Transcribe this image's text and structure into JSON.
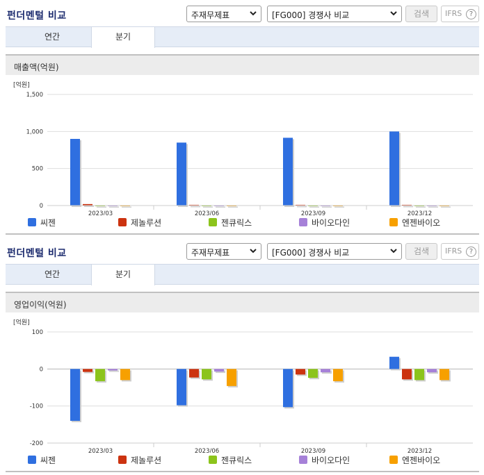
{
  "panels": [
    {
      "title": "펀더멘털 비교",
      "select1": "주재무제표",
      "select2": "[FG000] 경쟁사 비교",
      "search_label": "검색",
      "ifrs_label": "IFRS",
      "help_glyph": "?",
      "tabs": [
        "연간",
        "분기"
      ],
      "active_tab": "분기",
      "subtitle": "매출액(억원)",
      "unit_label": "[억원]"
    },
    {
      "title": "펀더멘털 비교",
      "select1": "주재무제표",
      "select2": "[FG000] 경쟁사 비교",
      "search_label": "검색",
      "ifrs_label": "IFRS",
      "help_glyph": "?",
      "tabs": [
        "연간",
        "분기"
      ],
      "active_tab": "분기",
      "subtitle": "영업이익(억원)",
      "unit_label": "[억원]"
    }
  ],
  "colors": {
    "씨젠": "#2f6fe0",
    "제놀루션": "#cc3310",
    "젠큐릭스": "#8cc41c",
    "바이오다인": "#a681d8",
    "엔젠바이오": "#f7a000"
  },
  "chart_data": [
    {
      "type": "bar",
      "title": "매출액(억원)",
      "ylabel": "[억원]",
      "categories": [
        "2023/03",
        "2023/06",
        "2023/09",
        "2023/12"
      ],
      "yticks": [
        "1,500",
        "1,000",
        "500",
        "0"
      ],
      "ylim": [
        0,
        1500
      ],
      "series": [
        {
          "name": "씨젠",
          "values": [
            900,
            850,
            915,
            1000
          ]
        },
        {
          "name": "제놀루션",
          "values": [
            20,
            10,
            10,
            10
          ]
        },
        {
          "name": "젠큐릭스",
          "values": [
            5,
            5,
            5,
            5
          ]
        },
        {
          "name": "바이오다인",
          "values": [
            5,
            5,
            5,
            5
          ]
        },
        {
          "name": "엔젠바이오",
          "values": [
            5,
            5,
            5,
            5
          ]
        }
      ]
    },
    {
      "type": "bar",
      "title": "영업이익(억원)",
      "ylabel": "[억원]",
      "categories": [
        "2023/03",
        "2023/06",
        "2023/09",
        "2023/12"
      ],
      "yticks": [
        "100",
        "0",
        "-100",
        "-200"
      ],
      "ylim": [
        -200,
        100
      ],
      "series": [
        {
          "name": "씨젠",
          "values": [
            -140,
            -98,
            -103,
            33
          ]
        },
        {
          "name": "제놀루션",
          "values": [
            -8,
            -23,
            -15,
            -28
          ]
        },
        {
          "name": "젠큐릭스",
          "values": [
            -33,
            -28,
            -24,
            -30
          ]
        },
        {
          "name": "바이오다인",
          "values": [
            -4,
            -7,
            -9,
            -9
          ]
        },
        {
          "name": "엔젠바이오",
          "values": [
            -30,
            -46,
            -33,
            -30
          ]
        }
      ]
    }
  ]
}
